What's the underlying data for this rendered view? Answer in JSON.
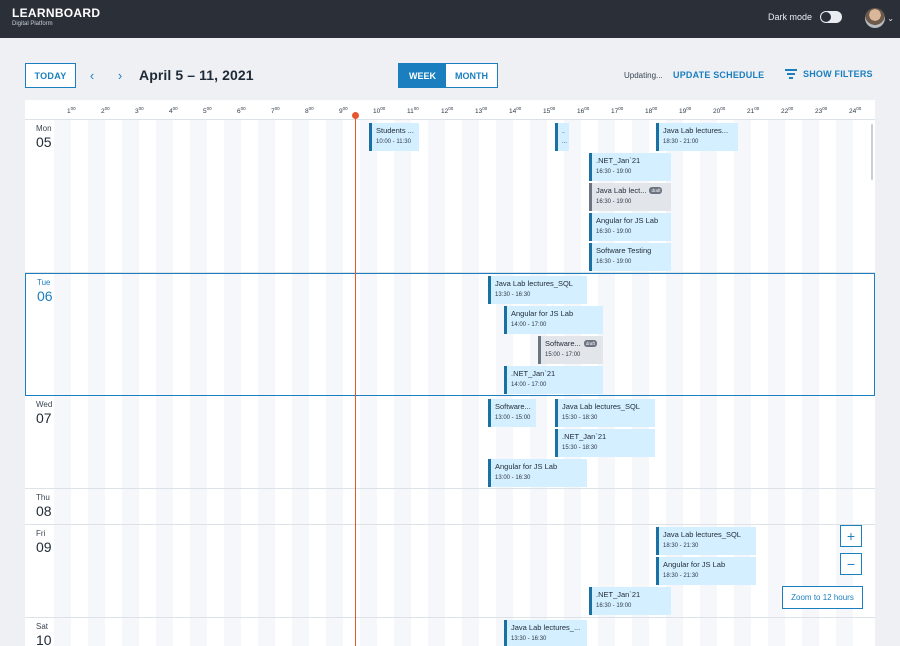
{
  "header": {
    "brand_title": "LEARNBOARD",
    "brand_subtitle": "Digital Platform",
    "dark_mode_label": "Dark mode",
    "dark_mode_on": false,
    "avatar_icon": "user-avatar",
    "caret": "⌄"
  },
  "toolbar": {
    "today_label": "TODAY",
    "prev_icon": "‹",
    "next_icon": "›",
    "date_range": "April 5 – 11, 2021",
    "views": [
      "WEEK",
      "MONTH"
    ],
    "active_view": "WEEK",
    "status": "Updating...",
    "update_label": "UPDATE SCHEDULE",
    "filters_label": "SHOW FILTERS"
  },
  "hours": [
    "1",
    "2",
    "3",
    "4",
    "5",
    "6",
    "7",
    "8",
    "9",
    "10",
    "11",
    "12",
    "13",
    "14",
    "15",
    "16",
    "17",
    "18",
    "19",
    "20",
    "21",
    "22",
    "23",
    "24"
  ],
  "hour_suffix": "00",
  "days": [
    {
      "dow": "Mon",
      "num": "05"
    },
    {
      "dow": "Tue",
      "num": "06"
    },
    {
      "dow": "Wed",
      "num": "07"
    },
    {
      "dow": "Thu",
      "num": "08"
    },
    {
      "dow": "Fri",
      "num": "09"
    },
    {
      "dow": "Sat",
      "num": "10"
    }
  ],
  "events": [
    {
      "day": 0,
      "title": "Students ...",
      "time": "10:00 - 11:30",
      "draft": false
    },
    {
      "day": 0,
      "title": "...",
      "time": "...",
      "draft": false
    },
    {
      "day": 0,
      "title": "Java Lab lectures...",
      "time": "18:30 - 21:00",
      "draft": false
    },
    {
      "day": 0,
      "title": ".NET_Jan`21",
      "time": "16:30 - 19:00",
      "draft": false
    },
    {
      "day": 0,
      "title": "Java Lab lect...",
      "time": "16:30 - 19:00",
      "draft": true,
      "badge": "draft"
    },
    {
      "day": 0,
      "title": "Angular for JS Lab",
      "time": "16:30 - 19:00",
      "draft": false
    },
    {
      "day": 0,
      "title": "Software Testing",
      "time": "16:30 - 19:00",
      "draft": false
    },
    {
      "day": 1,
      "title": "Java Lab lectures_SQL",
      "time": "13:30 - 16:30",
      "draft": false
    },
    {
      "day": 1,
      "title": "Angular for JS Lab",
      "time": "14:00 - 17:00",
      "draft": false
    },
    {
      "day": 1,
      "title": "Software...",
      "time": "15:00 - 17:00",
      "draft": true,
      "badge": "draft"
    },
    {
      "day": 1,
      "title": ".NET_Jan`21",
      "time": "14:00 - 17:00",
      "draft": false
    },
    {
      "day": 2,
      "title": "Software...",
      "time": "13:00 - 15:00",
      "draft": false
    },
    {
      "day": 2,
      "title": "Java Lab lectures_SQL",
      "time": "15:30 - 18:30",
      "draft": false
    },
    {
      "day": 2,
      "title": ".NET_Jan`21",
      "time": "15:30 - 18:30",
      "draft": false
    },
    {
      "day": 2,
      "title": "Angular for JS Lab",
      "time": "13:00 - 16:30",
      "draft": false
    },
    {
      "day": 4,
      "title": "Java Lab lectures_SQL",
      "time": "18:30 - 21:30",
      "draft": false
    },
    {
      "day": 4,
      "title": "Angular for JS Lab",
      "time": "18:30 - 21:30",
      "draft": false
    },
    {
      "day": 4,
      "title": ".NET_Jan`21",
      "time": "16:30 - 19:00",
      "draft": false
    },
    {
      "day": 5,
      "title": "Java Lab lectures_...",
      "time": "13:30 - 16:30",
      "draft": false
    }
  ],
  "zoom": {
    "in_label": "+",
    "out_label": "−",
    "hours_label": "Zoom to 12 hours"
  },
  "colors": {
    "accent": "#1b7fbf",
    "now_line": "#e4572e",
    "event_bg": "#d4efff",
    "draft_bg": "#e2e5ea",
    "header_bg": "#2b2f38"
  }
}
